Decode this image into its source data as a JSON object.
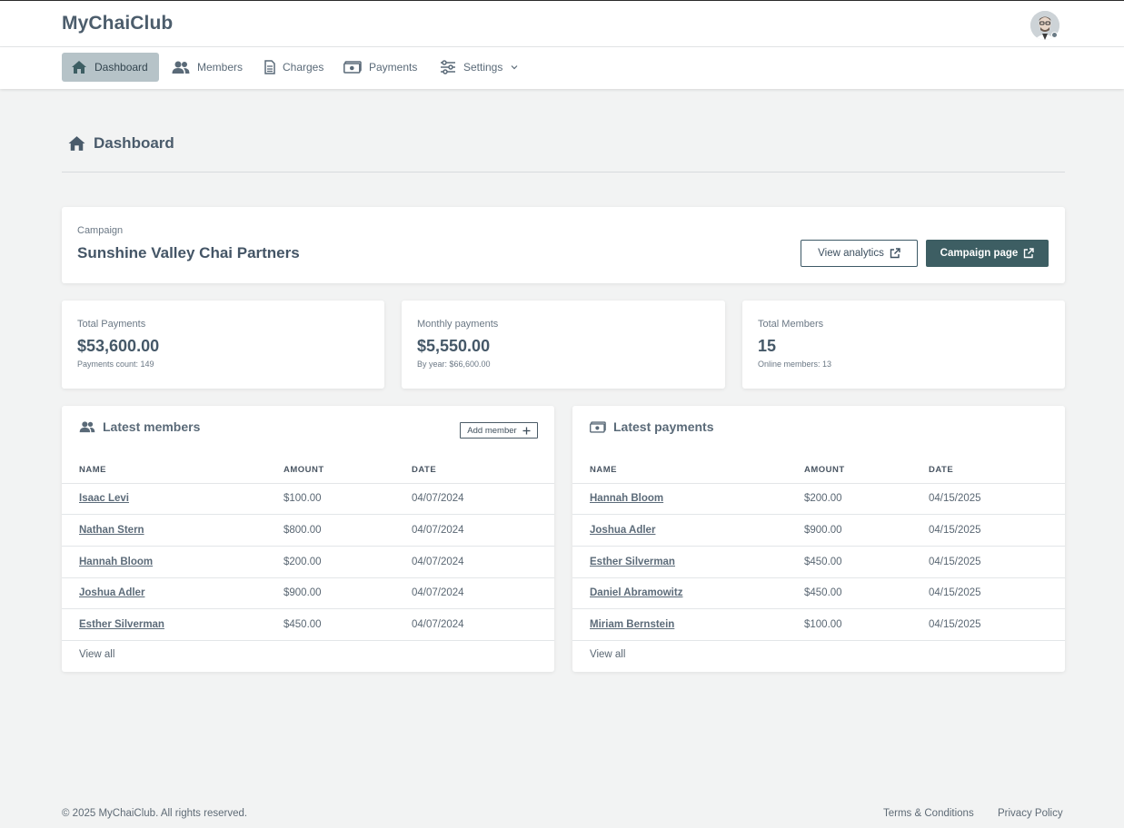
{
  "header": {
    "app_name": "MyChaiClub"
  },
  "nav": {
    "items": [
      {
        "label": "Dashboard",
        "icon": "home-icon"
      },
      {
        "label": "Members",
        "icon": "users-icon"
      },
      {
        "label": "Charges",
        "icon": "document-icon"
      },
      {
        "label": "Payments",
        "icon": "money-icon"
      },
      {
        "label": "Settings",
        "icon": "sliders-icon"
      }
    ]
  },
  "page": {
    "title": "Dashboard"
  },
  "campaign": {
    "label": "Campaign",
    "name": "Sunshine Valley Chai Partners",
    "view_analytics": "View analytics",
    "campaign_page": "Campaign page"
  },
  "stats": [
    {
      "label": "Total Payments",
      "value": "$53,600.00",
      "sub": "Payments count: 149"
    },
    {
      "label": "Monthly payments",
      "value": "$5,550.00",
      "sub": "By year: $66,600.00"
    },
    {
      "label": "Total Members",
      "value": "15",
      "sub": "Online members: 13"
    }
  ],
  "latest_members": {
    "title": "Latest members",
    "add_button": "Add member",
    "columns": [
      "NAME",
      "AMOUNT",
      "DATE"
    ],
    "rows": [
      {
        "name": "Isaac Levi",
        "amount": "$100.00",
        "date": "04/07/2024"
      },
      {
        "name": "Nathan Stern",
        "amount": "$800.00",
        "date": "04/07/2024"
      },
      {
        "name": "Hannah Bloom",
        "amount": "$200.00",
        "date": "04/07/2024"
      },
      {
        "name": "Joshua Adler",
        "amount": "$900.00",
        "date": "04/07/2024"
      },
      {
        "name": "Esther Silverman",
        "amount": "$450.00",
        "date": "04/07/2024"
      }
    ],
    "view_all": "View all"
  },
  "latest_payments": {
    "title": "Latest payments",
    "columns": [
      "NAME",
      "AMOUNT",
      "DATE"
    ],
    "rows": [
      {
        "name": "Hannah Bloom",
        "amount": "$200.00",
        "date": "04/15/2025"
      },
      {
        "name": "Joshua Adler",
        "amount": "$900.00",
        "date": "04/15/2025"
      },
      {
        "name": "Esther Silverman",
        "amount": "$450.00",
        "date": "04/15/2025"
      },
      {
        "name": "Daniel Abramowitz",
        "amount": "$450.00",
        "date": "04/15/2025"
      },
      {
        "name": "Miriam Bernstein",
        "amount": "$100.00",
        "date": "04/15/2025"
      }
    ],
    "view_all": "View all"
  },
  "footer": {
    "copyright": "© 2025 MyChaiClub. All rights reserved.",
    "terms": "Terms & Conditions",
    "privacy": "Privacy Policy"
  },
  "colors": {
    "accent": "#3d5e63",
    "nav_active_bg": "#b6c3c8",
    "background": "#f2f3f3"
  }
}
